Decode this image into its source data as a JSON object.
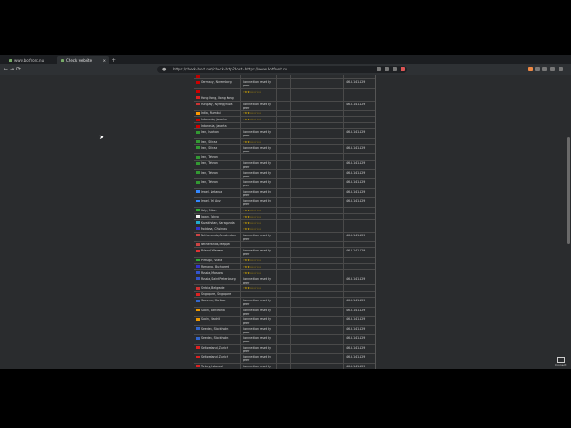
{
  "tabs": [
    {
      "label": "www.botfront.nu",
      "active": false
    },
    {
      "label": "Check website performance an...",
      "active": true
    }
  ],
  "address_bar": {
    "url": "https://check-host.net/check-http?host=https://www.botfront.nu"
  },
  "icons": {
    "back": "←",
    "forward": "→",
    "reload": "⟳",
    "new_tab": "+",
    "close": "×",
    "lock": "🔒"
  },
  "table": {
    "rows": [
      {
        "loc": "",
        "result": "",
        "ip": "",
        "flag": "#b00",
        "stars": false,
        "tall": false
      },
      {
        "loc": "Germany, Nuremberg",
        "result": "Connection reset by peer",
        "ip": "46.8.141.129",
        "flag": "#c00",
        "stars": false,
        "tall": true
      },
      {
        "loc": "",
        "result": "★★★☆☆☆☆☆",
        "ip": "",
        "flag": "#c00",
        "stars": true,
        "tall": false
      },
      {
        "loc": "Hong Kong, Hong Kong",
        "result": "",
        "ip": "",
        "flag": "#d22",
        "stars": false,
        "tall": false
      },
      {
        "loc": "Hungary, Nyiregyhaza",
        "result": "Connection reset by peer",
        "ip": "46.8.141.129",
        "flag": "#c33",
        "stars": false,
        "tall": true
      },
      {
        "loc": "India, Mumbai",
        "result": "★★★☆☆☆☆☆",
        "ip": "",
        "flag": "#f90",
        "stars": true,
        "tall": false
      },
      {
        "loc": "Indonesia, Jakarta",
        "result": "★★★☆☆☆☆☆",
        "ip": "",
        "flag": "#c00",
        "stars": true,
        "tall": false
      },
      {
        "loc": "Indonesia, Jakarta",
        "result": "",
        "ip": "",
        "flag": "#c00",
        "stars": false,
        "tall": false
      },
      {
        "loc": "Iran, Isfahan",
        "result": "Connection reset by peer",
        "ip": "46.8.141.129",
        "flag": "#393",
        "stars": false,
        "tall": true
      },
      {
        "loc": "Iran, Shiraz",
        "result": "★★★☆☆☆☆☆",
        "ip": "",
        "flag": "#393",
        "stars": true,
        "tall": false
      },
      {
        "loc": "Iran, Shiraz",
        "result": "Connection reset by peer",
        "ip": "46.8.141.129",
        "flag": "#393",
        "stars": false,
        "tall": true
      },
      {
        "loc": "Iran, Tehran",
        "result": "",
        "ip": "",
        "flag": "#393",
        "stars": false,
        "tall": false
      },
      {
        "loc": "Iran, Tehran",
        "result": "Connection reset by peer",
        "ip": "46.8.141.129",
        "flag": "#393",
        "stars": false,
        "tall": true
      },
      {
        "loc": "Iran, Tehran",
        "result": "Connection reset by peer",
        "ip": "46.8.141.129",
        "flag": "#393",
        "stars": false,
        "tall": true
      },
      {
        "loc": "Iran, Tehran",
        "result": "Connection reset by peer",
        "ip": "46.8.141.129",
        "flag": "#393",
        "stars": false,
        "tall": true
      },
      {
        "loc": "Israel, Netanya",
        "result": "Connection reset by peer",
        "ip": "46.8.141.129",
        "flag": "#38f",
        "stars": false,
        "tall": true
      },
      {
        "loc": "Israel, Tel Aviv",
        "result": "Connection reset by peer",
        "ip": "46.8.141.129",
        "flag": "#38f",
        "stars": false,
        "tall": true
      },
      {
        "loc": "Italy, Milan",
        "result": "★★★☆☆☆☆☆",
        "ip": "",
        "flag": "#3a3",
        "stars": true,
        "tall": false
      },
      {
        "loc": "Japan, Tokyo",
        "result": "★★★☆☆☆☆☆",
        "ip": "",
        "flag": "#eee",
        "stars": true,
        "tall": false
      },
      {
        "loc": "Kazakhstan, Karaganda",
        "result": "★★★☆☆☆☆☆",
        "ip": "",
        "flag": "#2ac",
        "stars": true,
        "tall": false
      },
      {
        "loc": "Moldova, Chisinau",
        "result": "★★★☆☆☆☆☆",
        "ip": "",
        "flag": "#33c",
        "stars": true,
        "tall": false
      },
      {
        "loc": "Netherlands, Amsterdam",
        "result": "Connection reset by peer",
        "ip": "46.8.141.129",
        "flag": "#c44",
        "stars": false,
        "tall": true
      },
      {
        "loc": "Netherlands, Meppel",
        "result": "",
        "ip": "",
        "flag": "#c44",
        "stars": false,
        "tall": false
      },
      {
        "loc": "Poland, Warsaw",
        "result": "Connection reset by peer",
        "ip": "46.8.141.129",
        "flag": "#d33",
        "stars": false,
        "tall": true
      },
      {
        "loc": "Portugal, Viana",
        "result": "★★★☆☆☆☆☆",
        "ip": "",
        "flag": "#3a3",
        "stars": true,
        "tall": false
      },
      {
        "loc": "Romania, Bucharest",
        "result": "★★★☆☆☆☆☆",
        "ip": "",
        "flag": "#33c",
        "stars": true,
        "tall": false
      },
      {
        "loc": "Russia, Moscow",
        "result": "★★★☆☆☆☆☆",
        "ip": "",
        "flag": "#35c",
        "stars": true,
        "tall": false
      },
      {
        "loc": "Russia, Saint Petersburg",
        "result": "Connection reset by peer",
        "ip": "46.8.141.129",
        "flag": "#35c",
        "stars": false,
        "tall": true
      },
      {
        "loc": "Serbia, Belgrade",
        "result": "★★★☆☆☆☆☆",
        "ip": "",
        "flag": "#c33",
        "stars": true,
        "tall": false
      },
      {
        "loc": "Singapore, Singapore",
        "result": "",
        "ip": "",
        "flag": "#d22",
        "stars": false,
        "tall": false
      },
      {
        "loc": "Slovenia, Maribor",
        "result": "Connection reset by peer",
        "ip": "46.8.141.129",
        "flag": "#36c",
        "stars": false,
        "tall": true
      },
      {
        "loc": "Spain, Barcelona",
        "result": "Connection reset by peer",
        "ip": "46.8.141.129",
        "flag": "#e90",
        "stars": false,
        "tall": true
      },
      {
        "loc": "Spain, Madrid",
        "result": "Connection reset by peer",
        "ip": "46.8.141.129",
        "flag": "#e90",
        "stars": false,
        "tall": true
      },
      {
        "loc": "Sweden, Stockholm",
        "result": "Connection reset by peer",
        "ip": "46.8.141.129",
        "flag": "#36c",
        "stars": false,
        "tall": true
      },
      {
        "loc": "Sweden, Stockholm",
        "result": "Connection reset by peer",
        "ip": "46.8.141.129",
        "flag": "#36c",
        "stars": false,
        "tall": true
      },
      {
        "loc": "Switzerland, Zurich",
        "result": "Connection reset by peer",
        "ip": "46.8.141.129",
        "flag": "#d22",
        "stars": false,
        "tall": true
      },
      {
        "loc": "Switzerland, Zurich",
        "result": "Connection reset by peer",
        "ip": "46.8.141.129",
        "flag": "#d22",
        "stars": false,
        "tall": true
      },
      {
        "loc": "Turkey, Istanbul",
        "result": "Connection reset by peer",
        "ip": "46.8.141.129",
        "flag": "#d22",
        "stars": false,
        "tall": true
      }
    ]
  },
  "widget": {
    "label": "Connect"
  }
}
